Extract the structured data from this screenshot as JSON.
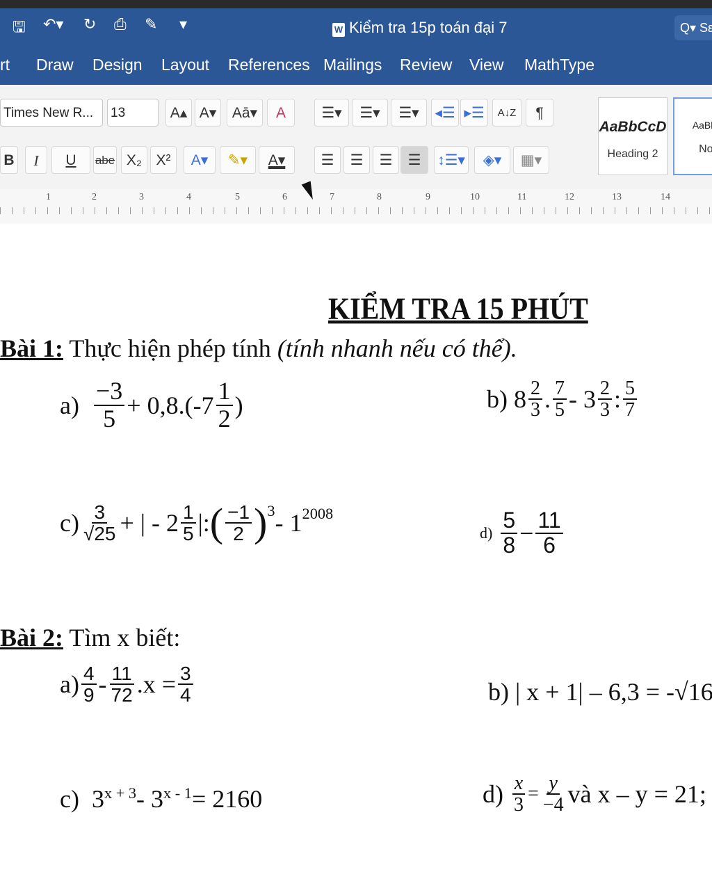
{
  "app": {
    "document_title": "Kiểm tra 15p toán đại 7",
    "search_label": "Q▾ Sε"
  },
  "quick_access": {
    "save": "🖫",
    "undo": "↶▾",
    "redo": "↻",
    "print": "⎙",
    "edit": "✎",
    "customize": "▾"
  },
  "menu": [
    "rt",
    "Draw",
    "Design",
    "Layout",
    "References",
    "Mailings",
    "Review",
    "View",
    "MathType"
  ],
  "ribbon": {
    "font_name": "Times New R...",
    "font_size": "13",
    "grow_font": "A▴",
    "shrink_font": "A▾",
    "change_case": "Aā▾",
    "clear_format": "A",
    "bold": "B",
    "italic": "I",
    "underline": "U",
    "strike": "abe",
    "subscript": "X₂",
    "superscript": "X²",
    "text_effects": "A▾",
    "highlight": "✎▾",
    "font_color": "A▾",
    "bullets": "☰▾",
    "numbering": "☰▾",
    "multilevel": "☰▾",
    "decrease_indent": "◂☰",
    "increase_indent": "▸☰",
    "sort": "A↓Z",
    "show_marks": "¶",
    "align_left": "☰",
    "align_center": "☰",
    "align_right": "☰",
    "justify": "☰",
    "line_spacing": "↕☰▾",
    "shading": "◈▾",
    "borders": "▦▾",
    "styles": [
      {
        "sample": "AaBbCcD",
        "name": "Heading 2"
      },
      {
        "sample": "AaBbC",
        "name": "Nor"
      }
    ]
  },
  "ruler_numbers": [
    "1",
    "2",
    "3",
    "4",
    "5",
    "6",
    "7",
    "8",
    "9",
    "10",
    "11",
    "12",
    "13",
    "14"
  ],
  "document": {
    "exam_title": "KIỂM TRA 15 PHÚT",
    "bai1": {
      "label": "Bài 1:",
      "text": " Thực hiện phép tính ",
      "note": "(tính nhanh nếu có thể)."
    },
    "bai2": {
      "label": "Bài 2:",
      "text": " Tìm x biết:"
    },
    "p1a": {
      "label": "a)",
      "f1n": "−3",
      "f1d": "5",
      "mid": "+ 0,8.(-7",
      "f2n": "1",
      "f2d": "2",
      "end": ")"
    },
    "p1b": {
      "label": "b) 8",
      "f1n": "2",
      "f1d": "3",
      "dot": ".",
      "f2n": "7",
      "f2d": "5",
      "mid": " -  3",
      "f3n": "2",
      "f3d": "3",
      "colon": ":",
      "f4n": "5",
      "f4d": "7"
    },
    "p1c": {
      "label": "c)",
      "f1n": "3",
      "f1d": "√25",
      "mid": "+ | - 2",
      "f2n": "1",
      "f2d": "5",
      "abs": "|:",
      "lp": "(",
      "f3n": "−1",
      "f3d": "2",
      "rp": ")",
      "exp": "3",
      "tail": " - 1",
      "exp2": "2008"
    },
    "p1d": {
      "label": "d)",
      "f1n": "5",
      "f1d": "8",
      "minus": "−",
      "f2n": "11",
      "f2d": "6"
    },
    "p2a": {
      "label": "a)",
      "f1n": "4",
      "f1d": "9",
      "minus": "-",
      "f2n": "11",
      "f2d": "72",
      "mid": ".x  =",
      "f3n": "3",
      "f3d": "4"
    },
    "p2b": {
      "label": "b) | x + 1| – 6,3 = -√16"
    },
    "p2c": {
      "label": "c)",
      "b1": "3",
      "e1": "x + 3",
      "mid": " -  3",
      "e2": "x - 1",
      "end": " = 2160"
    },
    "p2d": {
      "label": "d)",
      "f1n": "x",
      "f1d": "3",
      "eq": "=",
      "f2n": "y",
      "f2d": "−4",
      "end": " và x – y = 21;"
    }
  }
}
